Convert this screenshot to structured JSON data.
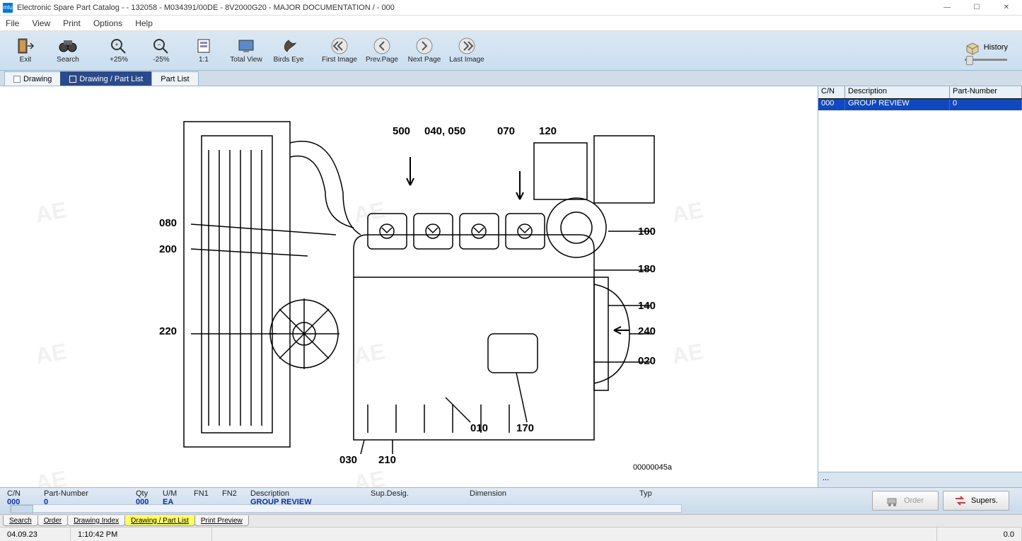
{
  "window": {
    "app_short": "mtu",
    "title": "Electronic Spare Part Catalog -  - 132058 - M034391/00DE - 8V2000G20 - MAJOR DOCUMENTATION / - 000",
    "min": "—",
    "max": "☐",
    "close": "✕"
  },
  "menu": {
    "file": "File",
    "view": "View",
    "print": "Print",
    "options": "Options",
    "help": "Help"
  },
  "toolbar": {
    "exit": "Exit",
    "search": "Search",
    "plus25": "+25%",
    "minus25": "-25%",
    "oneone": "1:1",
    "total": "Total View",
    "birds": "Birds Eye",
    "first": "First Image",
    "prev": "Prev.Page",
    "next": "Next Page",
    "last": "Last Image",
    "history": "History"
  },
  "subtabs": {
    "drawing": "Drawing",
    "dpl": "Drawing / Part List",
    "pl": "Part List"
  },
  "drawing": {
    "id": "00000045a",
    "callouts": {
      "c500": "500",
      "c040": "040, 050",
      "c070": "070",
      "c120": "120",
      "c080": "080",
      "c200": "200",
      "c220": "220",
      "c100": "100",
      "c180": "180",
      "c140": "140",
      "c240": "240",
      "c020": "020",
      "c010": "010",
      "c170": "170",
      "c030": "030",
      "c210": "210"
    }
  },
  "partlist": {
    "headers": {
      "cn": "C/N",
      "desc": "Description",
      "pn": "Part-Number"
    },
    "rows": [
      {
        "cn": "000",
        "desc": "GROUP REVIEW",
        "pn": "0"
      }
    ],
    "footer": "..."
  },
  "detail": {
    "headers": {
      "cn": "C/N",
      "pn": "Part-Number",
      "qty": "Qty",
      "um": "U/M",
      "fn1": "FN1",
      "fn2": "FN2",
      "desc": "Description",
      "sd": "Sup.Desig.",
      "dim": "Dimension",
      "typ": "Typ"
    },
    "values": {
      "cn": "000",
      "pn": "0",
      "qty": "000",
      "um": "EA",
      "fn1": "",
      "fn2": "",
      "desc": "GROUP REVIEW",
      "sd": "",
      "dim": "",
      "typ": ""
    }
  },
  "actions": {
    "order": "Order",
    "supers": "Supers."
  },
  "bottomtabs": {
    "search": "Search",
    "order": "Order",
    "di": "Drawing Index",
    "dpl": "Drawing / Part List",
    "pp": "Print Preview"
  },
  "status": {
    "date": "04.09.23",
    "time": "1:10:42 PM",
    "val": "0.0"
  },
  "watermark": "AE"
}
